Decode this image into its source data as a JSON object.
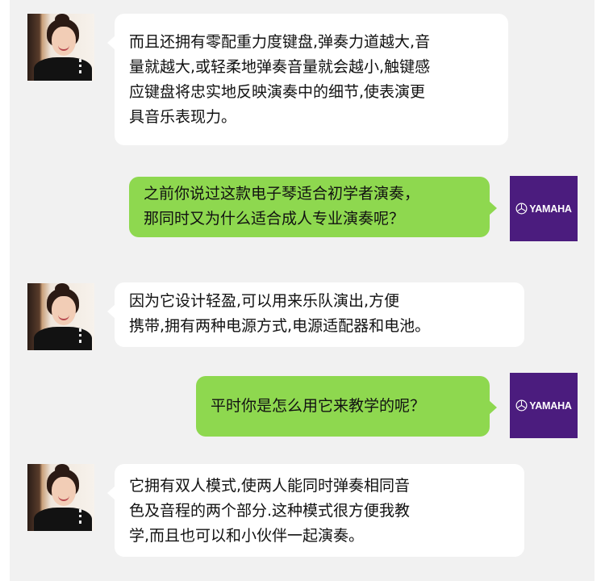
{
  "colors": {
    "chat_background": "#f1f1f1",
    "received_bubble": "#ffffff",
    "sent_bubble": "#8ed84f",
    "brand_avatar": "#4b1c7e"
  },
  "participants": {
    "teacher": {
      "avatar": "woman-portrait"
    },
    "student": {
      "avatar": "yamaha-logo",
      "logo_text": "YAMAHA"
    }
  },
  "messages": [
    {
      "sender": "teacher",
      "lines": [
        "而且还拥有零配重力度键盘,弹奏力道越大,音",
        "量就越大,或轻柔地弹奏音量就会越小,触键感",
        "应键盘将忠实地反映演奏中的细节,使表演更",
        "具音乐表现力。"
      ]
    },
    {
      "sender": "student",
      "lines": [
        "之前你说过这款电子琴适合初学者演奏，",
        "那同时又为什么适合成人专业演奏呢？"
      ]
    },
    {
      "sender": "teacher",
      "lines": [
        "因为它设计轻盈,可以用来乐队演出,方便",
        "携带,拥有两种电源方式,电源适配器和电池。"
      ]
    },
    {
      "sender": "student",
      "lines": [
        "平时你是怎么用它来教学的呢？"
      ]
    },
    {
      "sender": "teacher",
      "lines": [
        "它拥有双人模式,使两人能同时弹奏相同音",
        "色及音程的两个部分.这种模式很方便我教",
        "学,而且也可以和小伙伴一起演奏。"
      ]
    }
  ]
}
